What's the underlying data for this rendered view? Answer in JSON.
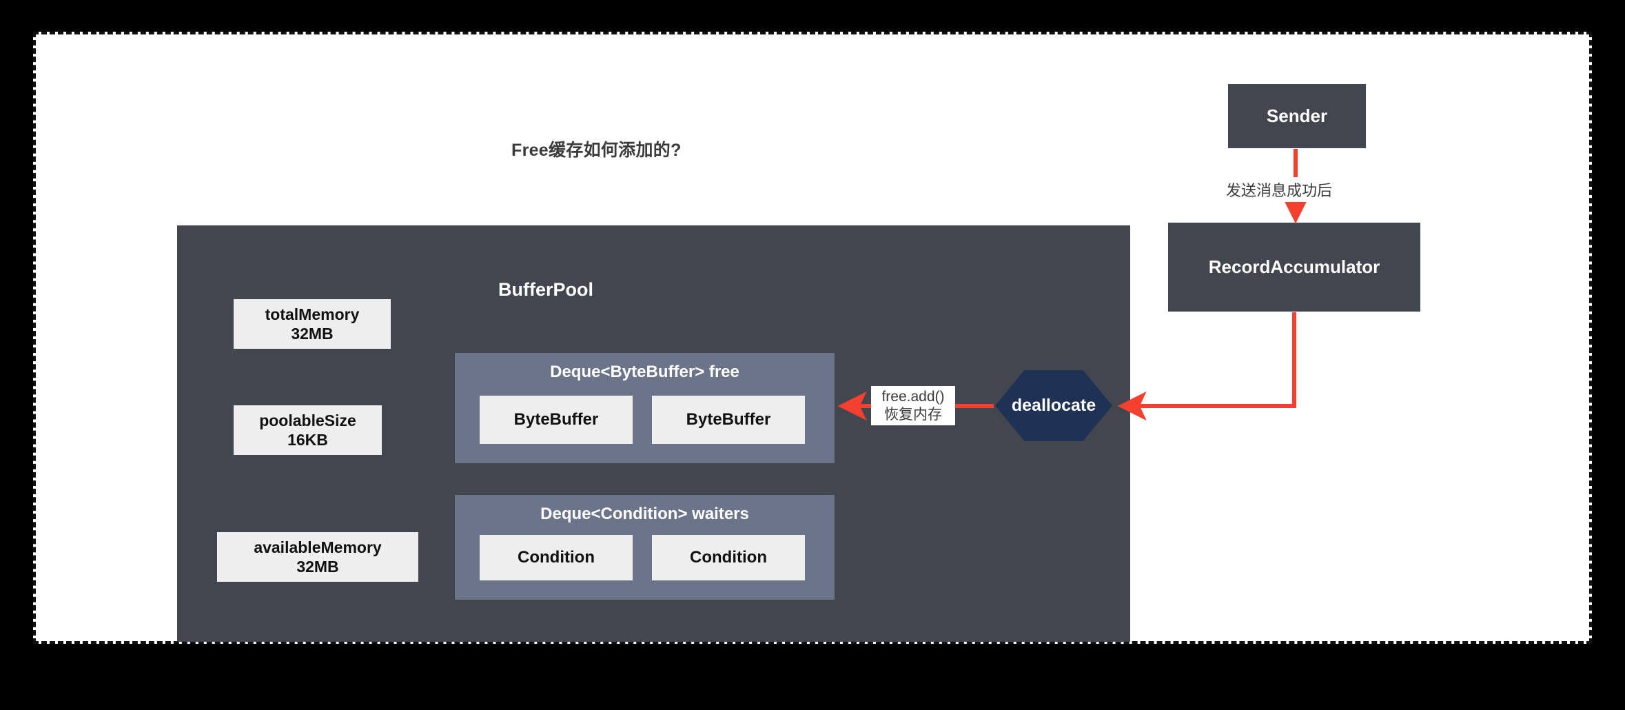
{
  "diagram": {
    "title": "Free缓存如何添加的?",
    "colors": {
      "page_background": "#000000",
      "sheet_background": "#ffffff",
      "sheet_border": "#111111",
      "panel_dark": "#42464f",
      "deque_container": "#6b7489",
      "item_light": "#eeeeee",
      "hexagon_navy": "#1f3256",
      "arrow_red": "#f4402f",
      "text_light": "#ffffff",
      "text_dark": "#3b3b3b"
    }
  },
  "buffer_pool": {
    "title": "BufferPool",
    "properties": [
      {
        "name": "totalMemory",
        "value": "32MB"
      },
      {
        "name": "poolableSize",
        "value": "16KB"
      },
      {
        "name": "availableMemory",
        "value": "32MB"
      }
    ],
    "deques": [
      {
        "title": "Deque<ByteBuffer> free",
        "items": [
          "ByteBuffer",
          "ByteBuffer"
        ]
      },
      {
        "title": "Deque<Condition> waiters",
        "items": [
          "Condition",
          "Condition"
        ]
      }
    ]
  },
  "nodes": {
    "sender": "Sender",
    "record_accumulator": "RecordAccumulator",
    "deallocate": "deallocate"
  },
  "edges": [
    {
      "id": "sender-to-accumulator",
      "from": "Sender",
      "to": "RecordAccumulator",
      "label": "发送消息成功后",
      "color": "#f4402f"
    },
    {
      "id": "accumulator-to-deallocate",
      "from": "RecordAccumulator",
      "to": "deallocate",
      "label": "",
      "color": "#f4402f"
    },
    {
      "id": "deallocate-to-free",
      "from": "deallocate",
      "to": "Deque<ByteBuffer> free",
      "label_line1": "free.add()",
      "label_line2": "恢复内存",
      "color": "#f4402f"
    }
  ]
}
